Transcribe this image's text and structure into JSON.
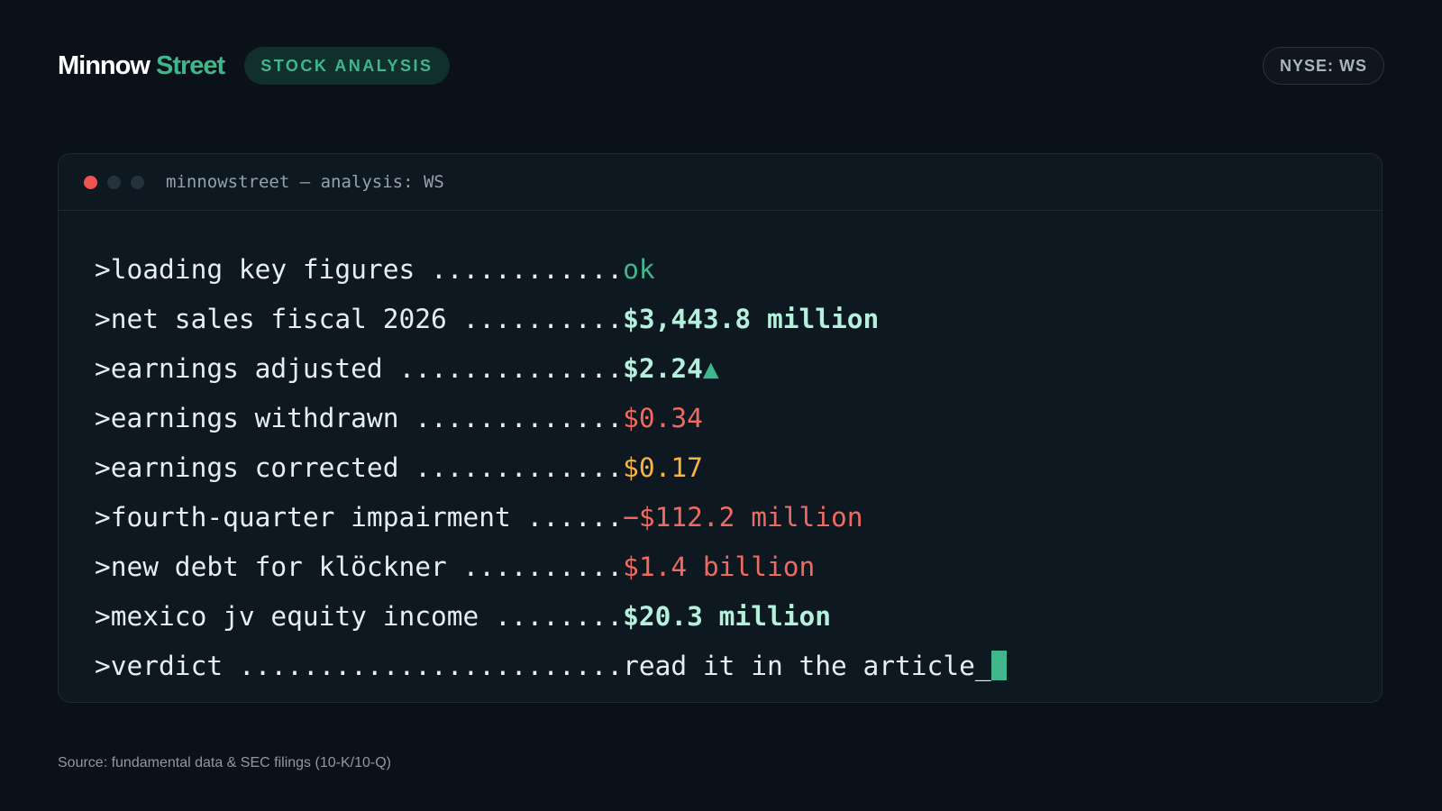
{
  "header": {
    "brand_main": "Minnow",
    "brand_accent": "Street",
    "tag": "STOCK ANALYSIS",
    "ticker": "NYSE: WS"
  },
  "terminal": {
    "title": "minnowstreet — analysis: WS",
    "lines": [
      {
        "prompt": ">",
        "label": "loading key figures ............",
        "value": "ok",
        "status": "ok"
      },
      {
        "prompt": ">",
        "label": "net sales fiscal 2026 ..........",
        "value": "$3,443.8 million",
        "status": "good"
      },
      {
        "prompt": ">",
        "label": "earnings adjusted ..............",
        "value": "$2.24",
        "status": "good",
        "indicator": "▲"
      },
      {
        "prompt": ">",
        "label": "earnings withdrawn .............",
        "value": "$0.34",
        "status": "bad"
      },
      {
        "prompt": ">",
        "label": "earnings corrected .............",
        "value": "$0.17",
        "status": "warn"
      },
      {
        "prompt": ">",
        "label": "fourth-quarter impairment ......",
        "value": "−$112.2 million",
        "status": "bad"
      },
      {
        "prompt": ">",
        "label": "new debt for klöckner ..........",
        "value": "$1.4 billion",
        "status": "bad"
      },
      {
        "prompt": ">",
        "label": "mexico jv equity income ........",
        "value": "$20.3 million",
        "status": "good"
      },
      {
        "prompt": ">",
        "label": "verdict ........................",
        "value": "read it in the article_",
        "status": "plain"
      }
    ]
  },
  "footer": {
    "source": "Source: fundamental data & SEC filings (10-K/10-Q)"
  },
  "colors": {
    "background": "#0b1118",
    "accent": "#3fb68b",
    "good": "#b4f0dc",
    "bad": "#ef6a60",
    "warn": "#f4b544"
  }
}
